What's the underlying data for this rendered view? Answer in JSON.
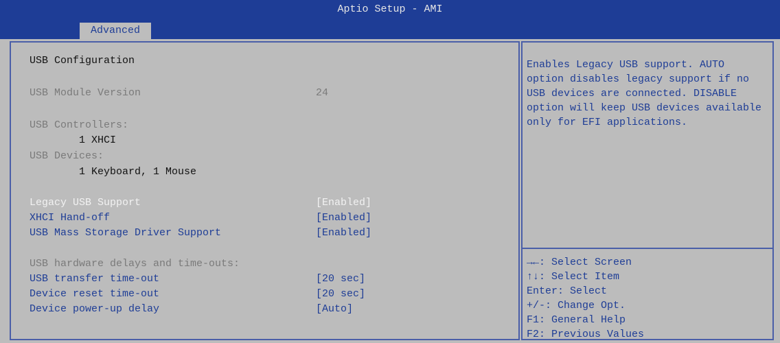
{
  "header": {
    "title": "Aptio Setup - AMI",
    "active_tab": "Advanced"
  },
  "main": {
    "heading": "USB Configuration",
    "module_version_label": "USB Module Version",
    "module_version_value": "24",
    "controllers_label": "USB Controllers:",
    "controllers_value": "1 XHCI",
    "devices_label": "USB Devices:",
    "devices_value": "1 Keyboard, 1 Mouse",
    "options": [
      {
        "label": "Legacy USB Support",
        "value": "[Enabled]"
      },
      {
        "label": "XHCI Hand-off",
        "value": "[Enabled]"
      },
      {
        "label": "USB Mass Storage Driver Support",
        "value": "[Enabled]"
      }
    ],
    "delays_heading": "USB hardware delays and time-outs:",
    "delays": [
      {
        "label": "USB transfer time-out",
        "value": "[20 sec]"
      },
      {
        "label": "Device reset time-out",
        "value": "[20 sec]"
      },
      {
        "label": "Device power-up delay",
        "value": "[Auto]"
      }
    ]
  },
  "help": {
    "text": "Enables Legacy USB support. AUTO option disables legacy support if no USB devices are connected. DISABLE option will keep USB devices available only for EFI applications."
  },
  "keys": [
    "→←: Select Screen",
    "↑↓: Select Item",
    "Enter: Select",
    "+/-: Change Opt.",
    "F1: General Help",
    "F2: Previous Values"
  ],
  "colors": {
    "background": "#bcbcbc",
    "header": "#1e3d96",
    "text_blue": "#1e3d96",
    "text_gray": "#7a7a7a",
    "selected_text": "#f2f2f2"
  }
}
